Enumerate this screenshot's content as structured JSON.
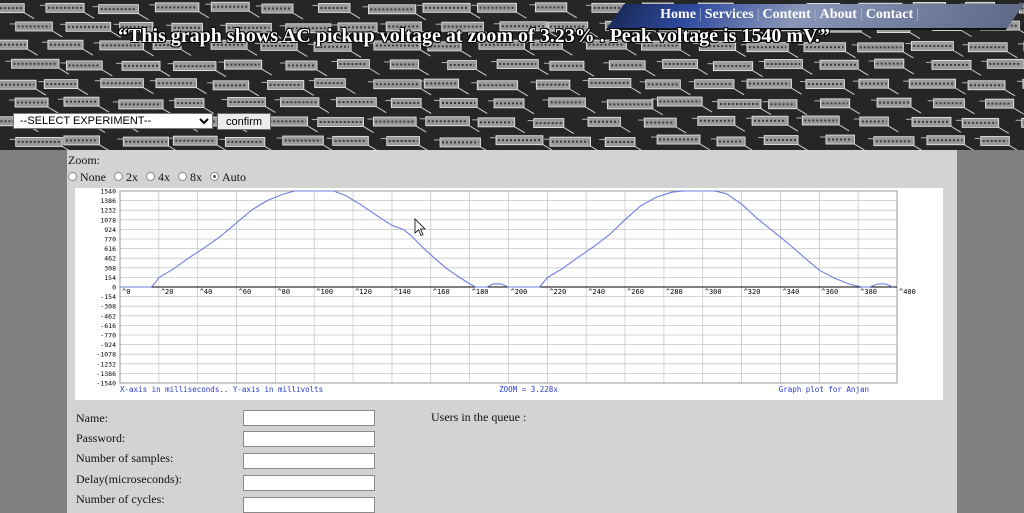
{
  "nav": {
    "items": [
      "Home",
      "Services",
      "Content",
      "About",
      "Contact"
    ],
    "separator": "|"
  },
  "header": {
    "headline": "“This graph shows AC pickup voltage at zoom of 3.23% . Peak voltage is 1540 mV.”"
  },
  "controls": {
    "experiment_select": "--SELECT EXPERIMENT--",
    "confirm_label": "confirm"
  },
  "zoom": {
    "label": "Zoom:",
    "options": [
      "None",
      "2x",
      "4x",
      "8x",
      "Auto"
    ],
    "selected": "Auto"
  },
  "chart_data": {
    "type": "line",
    "x_ticks": [
      "0",
      "20",
      "40",
      "60",
      "80",
      "100",
      "120",
      "140",
      "160",
      "180",
      "200",
      "220",
      "240",
      "260",
      "280",
      "300",
      "320",
      "340",
      "360",
      "380",
      "400"
    ],
    "y_ticks": [
      "1540",
      "1386",
      "1232",
      "1078",
      "924",
      "770",
      "616",
      "462",
      "308",
      "154",
      "0",
      "-154",
      "-308",
      "-462",
      "-616",
      "-770",
      "-924",
      "-1078",
      "-1232",
      "-1386",
      "-1540"
    ],
    "xlim": [
      0,
      400
    ],
    "ylim": [
      -1540,
      1540
    ],
    "grid": true,
    "footer_left": "X-axis in milliseconds.. Y-axis in millivolts",
    "footer_center": "ZOOM = 3.228x",
    "footer_right": "Graph plot for Anjan",
    "line_color": "#6e7de0",
    "series": [
      {
        "x": [
          0,
          8,
          16,
          18,
          20,
          28,
          36,
          44,
          52,
          60,
          68,
          76,
          84,
          90,
          96,
          104,
          110,
          116,
          124,
          132,
          140,
          146,
          150,
          156,
          162,
          168,
          174,
          180,
          183,
          186,
          189,
          192,
          196,
          200,
          204,
          208,
          212,
          216,
          220,
          228,
          236,
          244,
          252,
          260,
          268,
          276,
          284,
          290,
          300,
          306,
          312,
          320,
          328,
          336,
          344,
          352,
          360,
          368,
          376,
          382,
          386,
          390,
          394,
          398
        ],
        "y": [
          0,
          0,
          0,
          60,
          150,
          300,
          480,
          640,
          820,
          1030,
          1240,
          1390,
          1490,
          1540,
          1540,
          1540,
          1540,
          1470,
          1320,
          1150,
          990,
          920,
          820,
          630,
          460,
          300,
          170,
          50,
          0,
          0,
          0,
          50,
          50,
          0,
          0,
          0,
          0,
          0,
          150,
          300,
          480,
          650,
          840,
          1080,
          1300,
          1440,
          1520,
          1540,
          1540,
          1540,
          1500,
          1330,
          1100,
          900,
          700,
          480,
          270,
          140,
          40,
          0,
          0,
          50,
          50,
          0
        ]
      }
    ]
  },
  "form": {
    "labels": [
      "Name:",
      "Password:",
      "Number of samples:",
      "Delay(microseconds):",
      "Number of cycles:"
    ],
    "queue_label": "Users in the queue :"
  },
  "colors": {
    "panel_bg": "#d3d3d3",
    "page_bg": "#808080",
    "grid": "#c8c8c8",
    "axis_text": "#000000",
    "footer_text": "#2a3bd0"
  }
}
